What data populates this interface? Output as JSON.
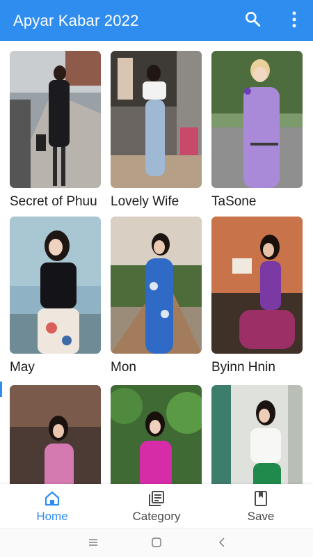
{
  "app_bar": {
    "title": "Apyar Kabar 2022",
    "background": "#2f8df0",
    "icons": [
      "search-icon",
      "more-vert-icon"
    ]
  },
  "grid": {
    "items": [
      {
        "caption": "Secret of Phuu"
      },
      {
        "caption": "Lovely Wife"
      },
      {
        "caption": "TaSone"
      },
      {
        "caption": "May"
      },
      {
        "caption": "Mon"
      },
      {
        "caption": "Byinn Hnin"
      },
      {
        "caption": ""
      },
      {
        "caption": ""
      },
      {
        "caption": ""
      }
    ]
  },
  "bottom_nav": {
    "items": [
      {
        "label": "Home",
        "icon": "home-icon",
        "active": true
      },
      {
        "label": "Category",
        "icon": "category-icon",
        "active": false
      },
      {
        "label": "Save",
        "icon": "bookmark-icon",
        "active": false
      }
    ]
  },
  "system_nav": {
    "icons": [
      "recents-icon",
      "home-circle-icon",
      "back-icon"
    ]
  }
}
